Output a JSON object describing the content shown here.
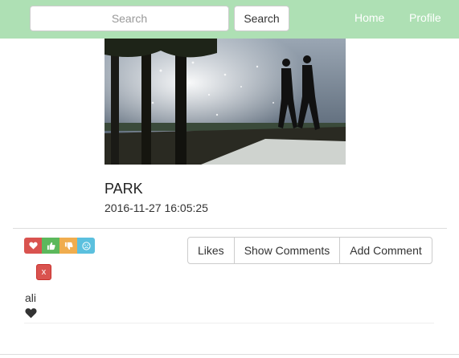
{
  "navbar": {
    "search_placeholder": "Search",
    "search_button": "Search",
    "links": [
      "Home",
      "Profile"
    ],
    "background": "#aee0b4"
  },
  "post": {
    "title": "PARK",
    "timestamp": "2016-11-27 16:05:25",
    "image": "park-lake-silhouettes-photo"
  },
  "reactions": [
    {
      "icon": "heart-icon",
      "color": "#d9534f"
    },
    {
      "icon": "thumbs-up-icon",
      "color": "#5cb85c"
    },
    {
      "icon": "thumbs-down-icon",
      "color": "#f0ad4e"
    },
    {
      "icon": "sad-face-icon",
      "color": "#5bc0de"
    }
  ],
  "delete_label": "x",
  "actions": [
    "Likes",
    "Show Comments",
    "Add Comment"
  ],
  "comments": [
    {
      "user": "ali",
      "reaction_icon": "heart-icon"
    }
  ]
}
